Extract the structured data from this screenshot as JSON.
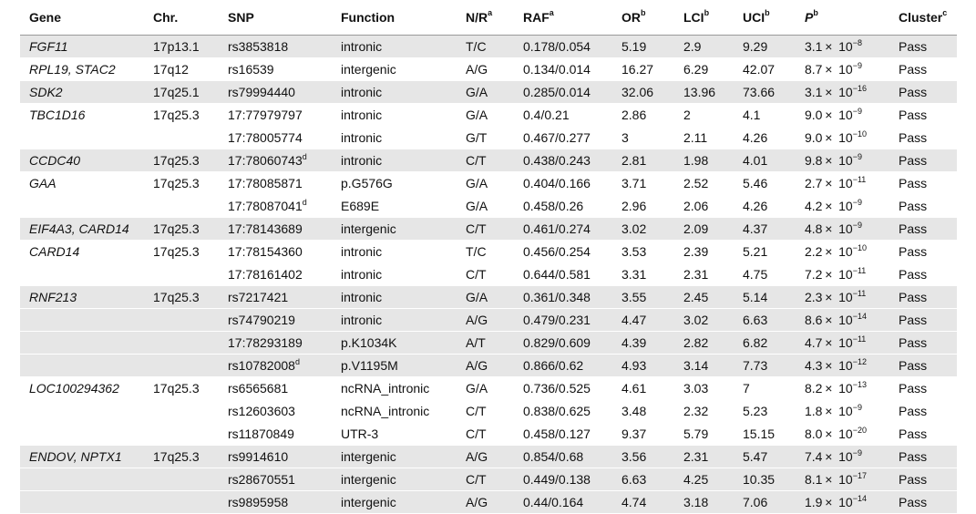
{
  "headers": [
    {
      "label": "Gene",
      "sup": ""
    },
    {
      "label": "Chr.",
      "sup": ""
    },
    {
      "label": "SNP",
      "sup": ""
    },
    {
      "label": "Function",
      "sup": ""
    },
    {
      "label": "N/R",
      "sup": "a"
    },
    {
      "label": "RAF",
      "sup": "a"
    },
    {
      "label": "OR",
      "sup": "b"
    },
    {
      "label": "LCI",
      "sup": "b"
    },
    {
      "label": "UCI",
      "sup": "b"
    },
    {
      "label": "P",
      "sup": "b"
    },
    {
      "label": "Cluster",
      "sup": "c"
    }
  ],
  "rows": [
    {
      "gene": "FGF11",
      "chr": "17p13.1",
      "snp": "rs3853818",
      "snp_sup": "",
      "function": "intronic",
      "nr": "T/C",
      "raf": "0.178/0.054",
      "or": "5.19",
      "lci": "2.9",
      "uci": "9.29",
      "p_mant": "3.1",
      "p_exp": "−8",
      "cluster": "Pass",
      "shade": true
    },
    {
      "gene": "RPL19, STAC2",
      "chr": "17q12",
      "snp": "rs16539",
      "snp_sup": "",
      "function": "intergenic",
      "nr": "A/G",
      "raf": "0.134/0.014",
      "or": "16.27",
      "lci": "6.29",
      "uci": "42.07",
      "p_mant": "8.7",
      "p_exp": "−9",
      "cluster": "Pass",
      "shade": false
    },
    {
      "gene": "SDK2",
      "chr": "17q25.1",
      "snp": "rs79994440",
      "snp_sup": "",
      "function": "intronic",
      "nr": "G/A",
      "raf": "0.285/0.014",
      "or": "32.06",
      "lci": "13.96",
      "uci": "73.66",
      "p_mant": "3.1",
      "p_exp": "−16",
      "cluster": "Pass",
      "shade": true
    },
    {
      "gene": "TBC1D16",
      "chr": "17q25.3",
      "snp": "17:77979797",
      "snp_sup": "",
      "function": "intronic",
      "nr": "G/A",
      "raf": "0.4/0.21",
      "or": "2.86",
      "lci": "2",
      "uci": "4.1",
      "p_mant": "9.0",
      "p_exp": "−9",
      "cluster": "Pass",
      "shade": false
    },
    {
      "gene": "",
      "chr": "",
      "snp": "17:78005774",
      "snp_sup": "",
      "function": "intronic",
      "nr": "G/T",
      "raf": "0.467/0.277",
      "or": "3",
      "lci": "2.11",
      "uci": "4.26",
      "p_mant": "9.0",
      "p_exp": "−10",
      "cluster": "Pass",
      "shade": false
    },
    {
      "gene": "CCDC40",
      "chr": "17q25.3",
      "snp": "17:78060743",
      "snp_sup": "d",
      "function": "intronic",
      "nr": "C/T",
      "raf": "0.438/0.243",
      "or": "2.81",
      "lci": "1.98",
      "uci": "4.01",
      "p_mant": "9.8",
      "p_exp": "−9",
      "cluster": "Pass",
      "shade": true
    },
    {
      "gene": "GAA",
      "chr": "17q25.3",
      "snp": "17:78085871",
      "snp_sup": "",
      "function": "p.G576G",
      "nr": "G/A",
      "raf": "0.404/0.166",
      "or": "3.71",
      "lci": "2.52",
      "uci": "5.46",
      "p_mant": "2.7",
      "p_exp": "−11",
      "cluster": "Pass",
      "shade": false
    },
    {
      "gene": "",
      "chr": "",
      "snp": "17:78087041",
      "snp_sup": "d",
      "function": "E689E",
      "nr": "G/A",
      "raf": "0.458/0.26",
      "or": "2.96",
      "lci": "2.06",
      "uci": "4.26",
      "p_mant": "4.2",
      "p_exp": "−9",
      "cluster": "Pass",
      "shade": false
    },
    {
      "gene": "EIF4A3, CARD14",
      "chr": "17q25.3",
      "snp": "17:78143689",
      "snp_sup": "",
      "function": "intergenic",
      "nr": "C/T",
      "raf": "0.461/0.274",
      "or": "3.02",
      "lci": "2.09",
      "uci": "4.37",
      "p_mant": "4.8",
      "p_exp": "−9",
      "cluster": "Pass",
      "shade": true
    },
    {
      "gene": "CARD14",
      "chr": "17q25.3",
      "snp": "17:78154360",
      "snp_sup": "",
      "function": "intronic",
      "nr": "T/C",
      "raf": "0.456/0.254",
      "or": "3.53",
      "lci": "2.39",
      "uci": "5.21",
      "p_mant": "2.2",
      "p_exp": "−10",
      "cluster": "Pass",
      "shade": false
    },
    {
      "gene": "",
      "chr": "",
      "snp": "17:78161402",
      "snp_sup": "",
      "function": "intronic",
      "nr": "C/T",
      "raf": "0.644/0.581",
      "or": "3.31",
      "lci": "2.31",
      "uci": "4.75",
      "p_mant": "7.2",
      "p_exp": "−11",
      "cluster": "Pass",
      "shade": false
    },
    {
      "gene": "RNF213",
      "chr": "17q25.3",
      "snp": "rs7217421",
      "snp_sup": "",
      "function": "intronic",
      "nr": "G/A",
      "raf": "0.361/0.348",
      "or": "3.55",
      "lci": "2.45",
      "uci": "5.14",
      "p_mant": "2.3",
      "p_exp": "−11",
      "cluster": "Pass",
      "shade": true
    },
    {
      "gene": "",
      "chr": "",
      "snp": "rs74790219",
      "snp_sup": "",
      "function": "intronic",
      "nr": "A/G",
      "raf": "0.479/0.231",
      "or": "4.47",
      "lci": "3.02",
      "uci": "6.63",
      "p_mant": "8.6",
      "p_exp": "−14",
      "cluster": "Pass",
      "shade": true
    },
    {
      "gene": "",
      "chr": "",
      "snp": "17:78293189",
      "snp_sup": "",
      "function": "p.K1034K",
      "nr": "A/T",
      "raf": "0.829/0.609",
      "or": "4.39",
      "lci": "2.82",
      "uci": "6.82",
      "p_mant": "4.7",
      "p_exp": "−11",
      "cluster": "Pass",
      "shade": true
    },
    {
      "gene": "",
      "chr": "",
      "snp": "rs10782008",
      "snp_sup": "d",
      "function": "p.V1195M",
      "nr": "A/G",
      "raf": "0.866/0.62",
      "or": "4.93",
      "lci": "3.14",
      "uci": "7.73",
      "p_mant": "4.3",
      "p_exp": "−12",
      "cluster": "Pass",
      "shade": true
    },
    {
      "gene": "LOC100294362",
      "chr": "17q25.3",
      "snp": "rs6565681",
      "snp_sup": "",
      "function": "ncRNA_intronic",
      "nr": "G/A",
      "raf": "0.736/0.525",
      "or": "4.61",
      "lci": "3.03",
      "uci": "7",
      "p_mant": "8.2",
      "p_exp": "−13",
      "cluster": "Pass",
      "shade": false
    },
    {
      "gene": "",
      "chr": "",
      "snp": "rs12603603",
      "snp_sup": "",
      "function": "ncRNA_intronic",
      "nr": "C/T",
      "raf": "0.838/0.625",
      "or": "3.48",
      "lci": "2.32",
      "uci": "5.23",
      "p_mant": "1.8",
      "p_exp": "−9",
      "cluster": "Pass",
      "shade": false
    },
    {
      "gene": "",
      "chr": "",
      "snp": "rs11870849",
      "snp_sup": "",
      "function": "UTR-3",
      "nr": "C/T",
      "raf": "0.458/0.127",
      "or": "9.37",
      "lci": "5.79",
      "uci": "15.15",
      "p_mant": "8.0",
      "p_exp": "−20",
      "cluster": "Pass",
      "shade": false
    },
    {
      "gene": "ENDOV, NPTX1",
      "chr": "17q25.3",
      "snp": "rs9914610",
      "snp_sup": "",
      "function": "intergenic",
      "nr": "A/G",
      "raf": "0.854/0.68",
      "or": "3.56",
      "lci": "2.31",
      "uci": "5.47",
      "p_mant": "7.4",
      "p_exp": "−9",
      "cluster": "Pass",
      "shade": true
    },
    {
      "gene": "",
      "chr": "",
      "snp": "rs28670551",
      "snp_sup": "",
      "function": "intergenic",
      "nr": "C/T",
      "raf": "0.449/0.138",
      "or": "6.63",
      "lci": "4.25",
      "uci": "10.35",
      "p_mant": "8.1",
      "p_exp": "−17",
      "cluster": "Pass",
      "shade": true
    },
    {
      "gene": "",
      "chr": "",
      "snp": "rs9895958",
      "snp_sup": "",
      "function": "intergenic",
      "nr": "A/G",
      "raf": "0.44/0.164",
      "or": "4.74",
      "lci": "3.18",
      "uci": "7.06",
      "p_mant": "1.9",
      "p_exp": "−14",
      "cluster": "Pass",
      "shade": true
    }
  ],
  "p_times": "× 10"
}
